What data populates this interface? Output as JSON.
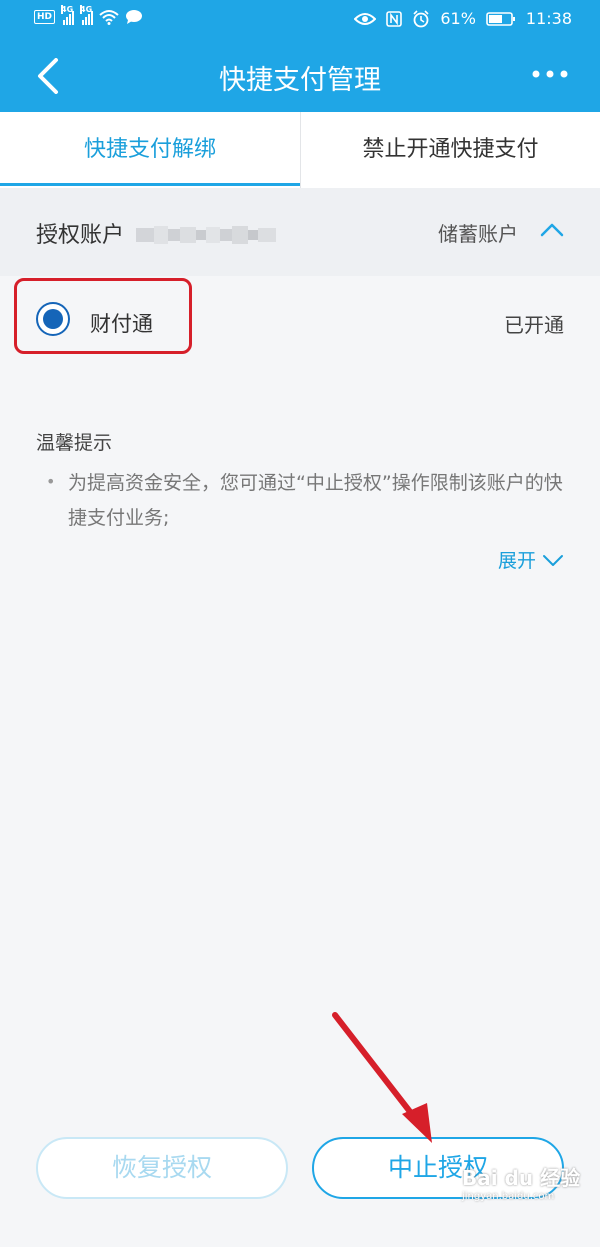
{
  "status_bar": {
    "hd": "HD",
    "net1": "4G",
    "net2": "4G",
    "battery": "61%",
    "time": "11:38"
  },
  "nav": {
    "title": "快捷支付管理",
    "back_icon": "chevron-left-icon",
    "more_icon": "more-dots-icon"
  },
  "tabs": [
    {
      "label": "快捷支付解绑",
      "active": true
    },
    {
      "label": "禁止开通快捷支付",
      "active": false
    }
  ],
  "account": {
    "label": "授权账户",
    "type": "储蓄账户",
    "toggle_icon": "chevron-up-icon"
  },
  "bank": {
    "name": "财付通",
    "status": "已开通",
    "selected": true
  },
  "tips": {
    "title": "温馨提示",
    "items": [
      "为提高资金安全，您可通过“中止授权”操作限制该账户的快捷支付业务;"
    ],
    "expand_label": "展开"
  },
  "buttons": {
    "restore": "恢复授权",
    "stop": "中止授权"
  },
  "watermark": {
    "main": "Bai du 经验",
    "sub": "jingyan.baidu.com"
  },
  "colors": {
    "primary": "#1fa6e6",
    "annotation": "#d61f2a",
    "radio": "#1565b8"
  }
}
